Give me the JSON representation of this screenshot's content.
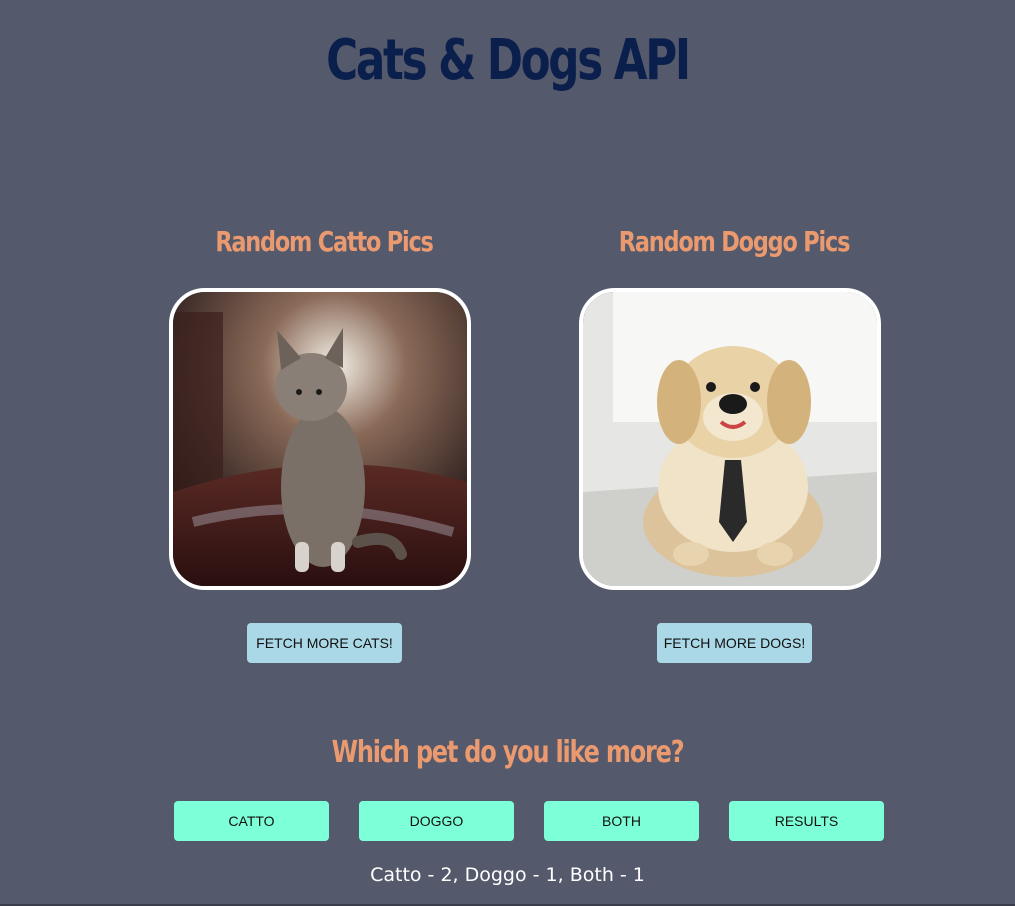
{
  "header": {
    "title": "Cats & Dogs API"
  },
  "cats": {
    "title": "Random Catto Pics",
    "image_icon": "kitten-photo",
    "button_label": "FETCH MORE CATS!"
  },
  "dogs": {
    "title": "Random Doggo Pics",
    "image_icon": "puppy-photo",
    "button_label": "FETCH MORE DOGS!"
  },
  "vote": {
    "question": "Which pet do you like more?",
    "buttons": [
      {
        "label": "CATTO"
      },
      {
        "label": "DOGGO"
      },
      {
        "label": "BOTH"
      },
      {
        "label": "RESULTS"
      }
    ],
    "results": "Catto - 2, Doggo - 1, Both - 1"
  },
  "colors": {
    "background": "#545a6c",
    "title": "#0b1f4d",
    "accent": "#eb9a70",
    "fetch_button": "#aad8e6",
    "vote_button": "#7dffd7"
  }
}
